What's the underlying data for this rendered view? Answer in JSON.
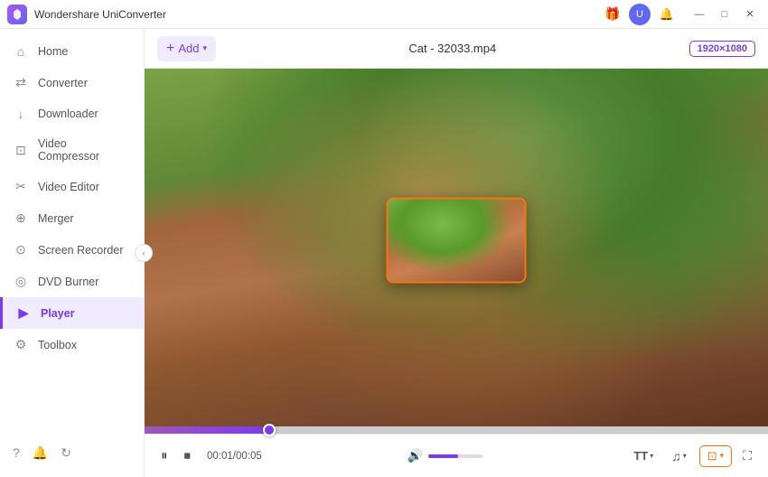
{
  "app": {
    "title": "Wondershare UniConverter",
    "logo_alt": "UniConverter logo"
  },
  "titlebar": {
    "right_icons": [
      "gift",
      "user",
      "bell"
    ],
    "controls": [
      "minimize",
      "maximize",
      "close"
    ],
    "gift_label": "🎁",
    "user_label": "U",
    "bell_label": "🔔",
    "minimize_label": "—",
    "maximize_label": "□",
    "close_label": "✕"
  },
  "sidebar": {
    "items": [
      {
        "id": "home",
        "label": "Home",
        "icon": "⌂"
      },
      {
        "id": "converter",
        "label": "Converter",
        "icon": "⇄"
      },
      {
        "id": "downloader",
        "label": "Downloader",
        "icon": "↓"
      },
      {
        "id": "video-compressor",
        "label": "Video Compressor",
        "icon": "⊡"
      },
      {
        "id": "video-editor",
        "label": "Video Editor",
        "icon": "✂"
      },
      {
        "id": "merger",
        "label": "Merger",
        "icon": "⊕"
      },
      {
        "id": "screen-recorder",
        "label": "Screen Recorder",
        "icon": "⊙"
      },
      {
        "id": "dvd-burner",
        "label": "DVD Burner",
        "icon": "◎"
      },
      {
        "id": "player",
        "label": "Player",
        "icon": "▶",
        "active": true
      },
      {
        "id": "toolbox",
        "label": "Toolbox",
        "icon": "⚙"
      }
    ],
    "bottom_icons": [
      "?",
      "🔔",
      "↻"
    ]
  },
  "player": {
    "add_media_label": "+ Add",
    "filename": "Cat - 32033.mp4",
    "resolution": "1920×1080",
    "current_time": "00:01",
    "total_time": "00:05",
    "time_display": "00:01/00:05",
    "progress_percent": 20,
    "volume_percent": 55
  },
  "controls": {
    "play_pause_label": "⏸",
    "stop_label": "⏹",
    "caption_label": "TT",
    "audio_label": "♪",
    "pip_label": "PiP",
    "fullscreen_label": "⛶"
  }
}
